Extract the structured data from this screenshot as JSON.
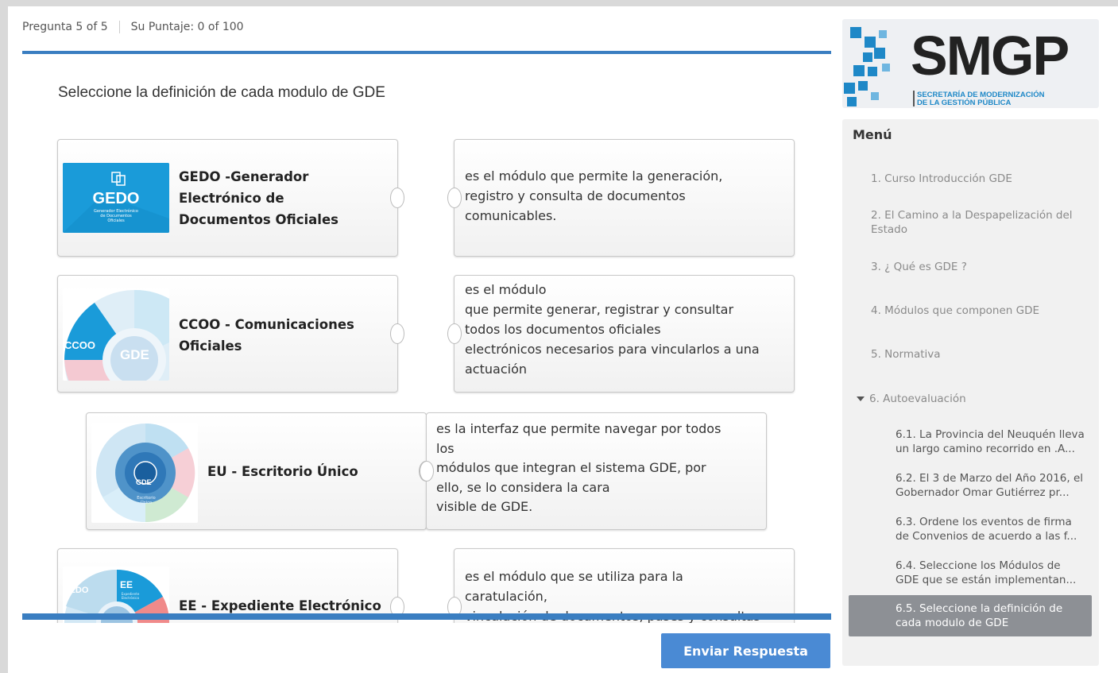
{
  "header": {
    "question_counter": "Pregunta 5 of 5",
    "score": "Su Puntaje: 0 of 100"
  },
  "question": {
    "title": "Seleccione la definición de cada modulo de GDE"
  },
  "pairs": [
    {
      "module_name": "GEDO -Generador\nElectrónico de\nDocumentos Oficiales",
      "thumb_label": "GEDO",
      "thumb_caption": "Generador Electrónico\nde Documentos\nOficiales",
      "definition": "es el módulo que permite la generación,\nregistro y consulta de documentos\ncomunicables."
    },
    {
      "module_name": "CCOO - Comunicaciones\nOficiales",
      "thumb_label": "CCOO",
      "thumb_center": "GDE",
      "definition": "es el módulo\nque permite generar, registrar y consultar\ntodos los documentos oficiales\nelectrónicos necesarios para vincularlos a una\nactuación"
    },
    {
      "module_name": "EU - Escritorio Único",
      "thumb_center": "GDE",
      "thumb_sub": "Escritorio\nÚnico",
      "definition": "es la interfaz que permite navegar por todos\nlos\nmódulos que integran el sistema GDE, por\nello, se lo considera la cara\nvisible de GDE."
    },
    {
      "module_name": "EE - Expediente Electrónico",
      "thumb_label": "EE",
      "thumb_sub": "Expediente\nElectrónico",
      "thumb_side": "GEDO",
      "definition": "es el módulo que se utiliza para la\ncaratulación,\nvinculación de documentos, pases y consultas"
    }
  ],
  "submit_label": "Enviar Respuesta",
  "logo": {
    "text": "SMGP",
    "subtitle_line1": "SECRETARÍA DE MODERNIZACIÓN",
    "subtitle_line2": "DE LA GESTIÓN PÚBLICA"
  },
  "menu": {
    "title": "Menú",
    "items": [
      "1. Curso Introducción GDE",
      "2. El Camino a la Despapelización del Estado",
      "3. ¿ Qué es GDE ?",
      "4. Módulos que componen GDE",
      "5. Normativa",
      "6. Autoevaluación"
    ],
    "subitems": [
      "6.1. La Provincia del Neuquén lleva un largo camino recorrido en .A...",
      "6.2. El 3 de Marzo del Año 2016, el Gobernador Omar Gutiérrez pr...",
      "6.3. Ordene los eventos de firma de Convenios de acuerdo a las f...",
      "6.4. Seleccione los Módulos de GDE que se están implementan...",
      "6.5. Seleccione la definición de cada modulo de GDE"
    ]
  },
  "colors": {
    "accent": "#3a7ec1",
    "button": "#4a8ad4",
    "active_menu": "#8d9095",
    "logo_dark": "#222222",
    "logo_blue": "#1e88c7"
  }
}
